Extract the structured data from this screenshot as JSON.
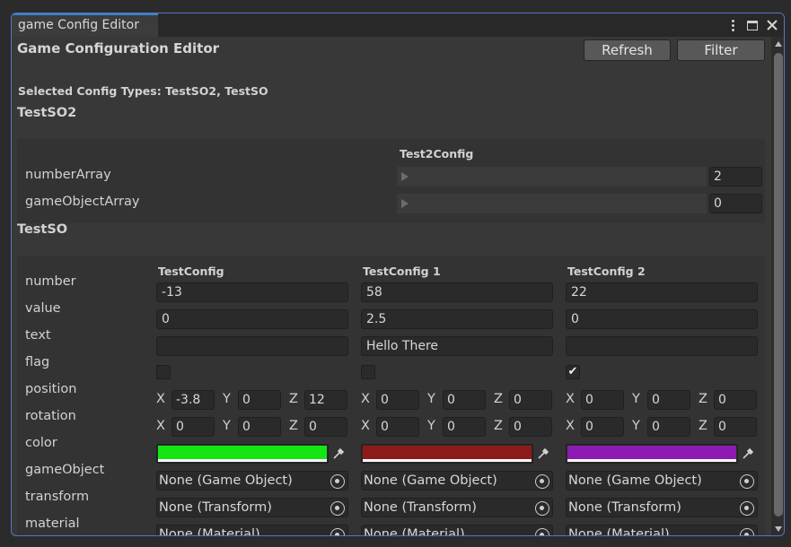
{
  "window": {
    "tab_title": "game Config Editor",
    "icons": [
      "more-options-icon",
      "maximize-icon",
      "close-icon"
    ]
  },
  "header": {
    "title": "Game Configuration Editor",
    "refresh_label": "Refresh",
    "filter_label": "Filter",
    "selected_types": "Selected Config Types: TestSO2, TestSO"
  },
  "sections": [
    {
      "title": "TestSO2",
      "columns": [
        "Test2Config"
      ],
      "rows": [
        {
          "label": "numberArray",
          "count": "2"
        },
        {
          "label": "gameObjectArray",
          "count": "0"
        }
      ]
    },
    {
      "title": "TestSO",
      "columns": [
        "TestConfig",
        "TestConfig 1",
        "TestConfig 2"
      ],
      "labels": {
        "number": "number",
        "value": "value",
        "text": "text",
        "flag": "flag",
        "position": "position",
        "rotation": "rotation",
        "color": "color",
        "gameObject": "gameObject",
        "transform": "transform",
        "material": "material"
      },
      "axes": [
        "X",
        "Y",
        "Z"
      ],
      "configs": [
        {
          "number": "-13",
          "value": "0",
          "text": "",
          "flag": false,
          "position": [
            "-3.8",
            "0",
            "12"
          ],
          "rotation": [
            "0",
            "0",
            "0"
          ],
          "color": "#14e614",
          "gameObject": "None (Game Object)",
          "transform": "None (Transform)",
          "material": "None (Material)"
        },
        {
          "number": "58",
          "value": "2.5",
          "text": "Hello There",
          "flag": false,
          "position": [
            "0",
            "0",
            "0"
          ],
          "rotation": [
            "0",
            "0",
            "0"
          ],
          "color": "#8f1a1a",
          "gameObject": "None (Game Object)",
          "transform": "None (Transform)",
          "material": "None (Material)"
        },
        {
          "number": "22",
          "value": "0",
          "text": "",
          "flag": true,
          "position": [
            "0",
            "0",
            "0"
          ],
          "rotation": [
            "0",
            "0",
            "0"
          ],
          "color": "#8c1ab3",
          "gameObject": "None (Game Object)",
          "transform": "None (Transform)",
          "material": "None (Material)"
        }
      ]
    }
  ],
  "colors": {
    "accent": "#5b74c7",
    "tab_highlight": "#3b82c6"
  }
}
